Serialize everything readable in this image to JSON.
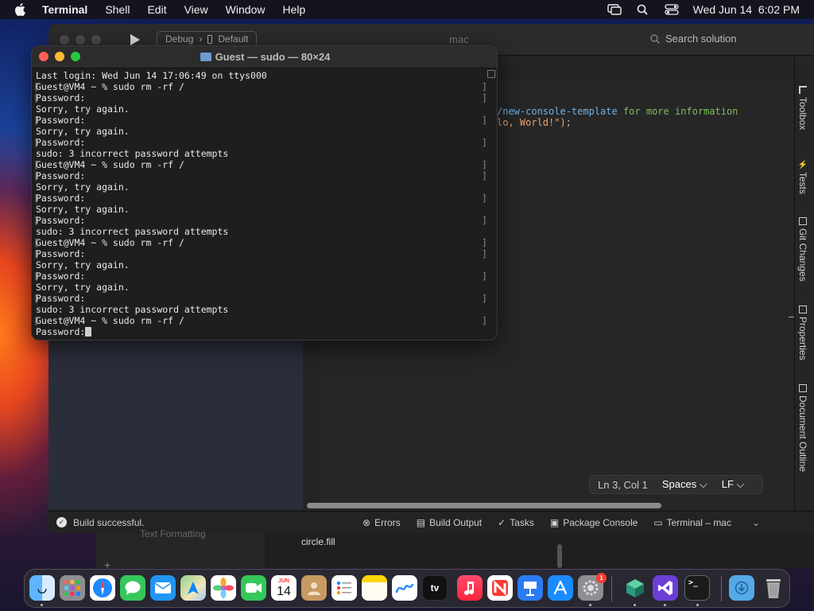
{
  "menubar": {
    "app_name": "Terminal",
    "items": [
      "Shell",
      "Edit",
      "View",
      "Window",
      "Help"
    ],
    "clock": "Wed Jun 14  6:02 PM"
  },
  "ide": {
    "window_title": "mac",
    "config": "Debug",
    "config_sep": "›",
    "target": "Default",
    "search_placeholder": "Search solution",
    "right_tabs": [
      "Toolbox",
      "Tests",
      "Git Changes",
      "Properties",
      "Document Outline"
    ],
    "code_lines": [
      {
        "prefix": "/new-console-template",
        "rest": " for more information"
      },
      {
        "prefix": "lo, World!\");",
        "rest": ""
      }
    ],
    "status_position": "Ln 3, Col 1",
    "status_indent": "Spaces",
    "status_eol": "LF",
    "build_status": "Build successful.",
    "bottom_tabs": [
      "Errors",
      "Build Output",
      "Tasks",
      "Package Console",
      "Terminal – mac"
    ],
    "under_text_1": "Text Formatting",
    "under_text_2": "circle.fill"
  },
  "terminal": {
    "title": "Guest — sudo — 80×24",
    "lines": [
      "Last login: Wed Jun 14 17:06:49 on ttys000",
      "Guest@VM4 ~ % sudo rm -rf /",
      "Password:",
      "Sorry, try again.",
      "Password:",
      "Sorry, try again.",
      "Password:",
      "sudo: 3 incorrect password attempts",
      "Guest@VM4 ~ % sudo rm -rf /",
      "Password:",
      "Sorry, try again.",
      "Password:",
      "Sorry, try again.",
      "Password:",
      "sudo: 3 incorrect password attempts",
      "Guest@VM4 ~ % sudo rm -rf /",
      "Password:",
      "Sorry, try again.",
      "Password:",
      "Sorry, try again.",
      "Password:",
      "sudo: 3 incorrect password attempts",
      "Guest@VM4 ~ % sudo rm -rf /",
      "Password:"
    ]
  },
  "dock": {
    "calendar_month": "JUN",
    "calendar_day": "14",
    "tv_label": "tv",
    "settings_badge": "1",
    "apps": [
      "finder",
      "launchpad",
      "safari",
      "messages",
      "mail",
      "maps",
      "photos",
      "facetime",
      "calendar",
      "contacts",
      "reminders",
      "notes",
      "freeform",
      "tv",
      "music",
      "news",
      "keynote",
      "app-store",
      "system-settings",
      "dotnet",
      "visual-studio",
      "terminal",
      "downloads",
      "trash"
    ]
  }
}
